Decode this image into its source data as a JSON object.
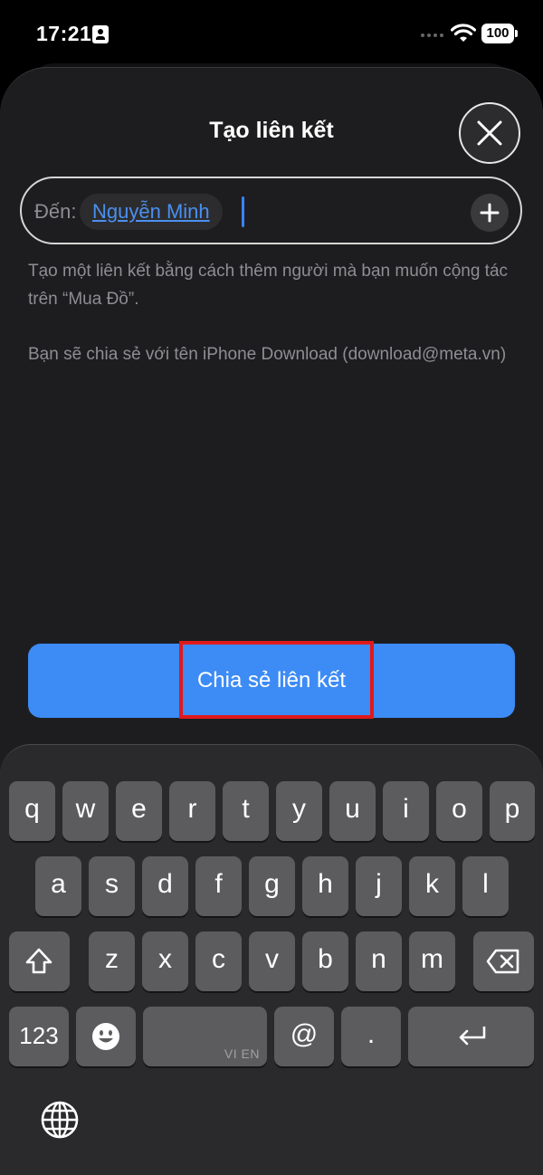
{
  "status": {
    "time": "17:21",
    "battery": "100"
  },
  "sheet": {
    "title": "Tạo liên kết",
    "to_label": "Đến:",
    "recipient": "Nguyễn Minh",
    "description_1": "Tạo một liên kết bằng cách thêm người mà bạn muốn cộng tác trên “Mua Đồ”.",
    "description_2": "Bạn sẽ chia sẻ với tên iPhone Download (download@meta.vn)",
    "share_button": "Chia sẻ liên kết"
  },
  "keyboard": {
    "row1": [
      "q",
      "w",
      "e",
      "r",
      "t",
      "y",
      "u",
      "i",
      "o",
      "p"
    ],
    "row2": [
      "a",
      "s",
      "d",
      "f",
      "g",
      "h",
      "j",
      "k",
      "l"
    ],
    "row3": [
      "z",
      "x",
      "c",
      "v",
      "b",
      "n",
      "m"
    ],
    "numbers_key": "123",
    "at_key": "@",
    "dot_key": ".",
    "space_hint": "VI EN"
  },
  "icons": {
    "close": "close-icon",
    "add": "plus-icon",
    "shift": "shift-icon",
    "delete": "backspace-icon",
    "emoji": "emoji-icon",
    "return": "return-icon",
    "globe": "globe-icon"
  },
  "colors": {
    "accent": "#3d8bf5",
    "highlight": "#e0191b"
  }
}
